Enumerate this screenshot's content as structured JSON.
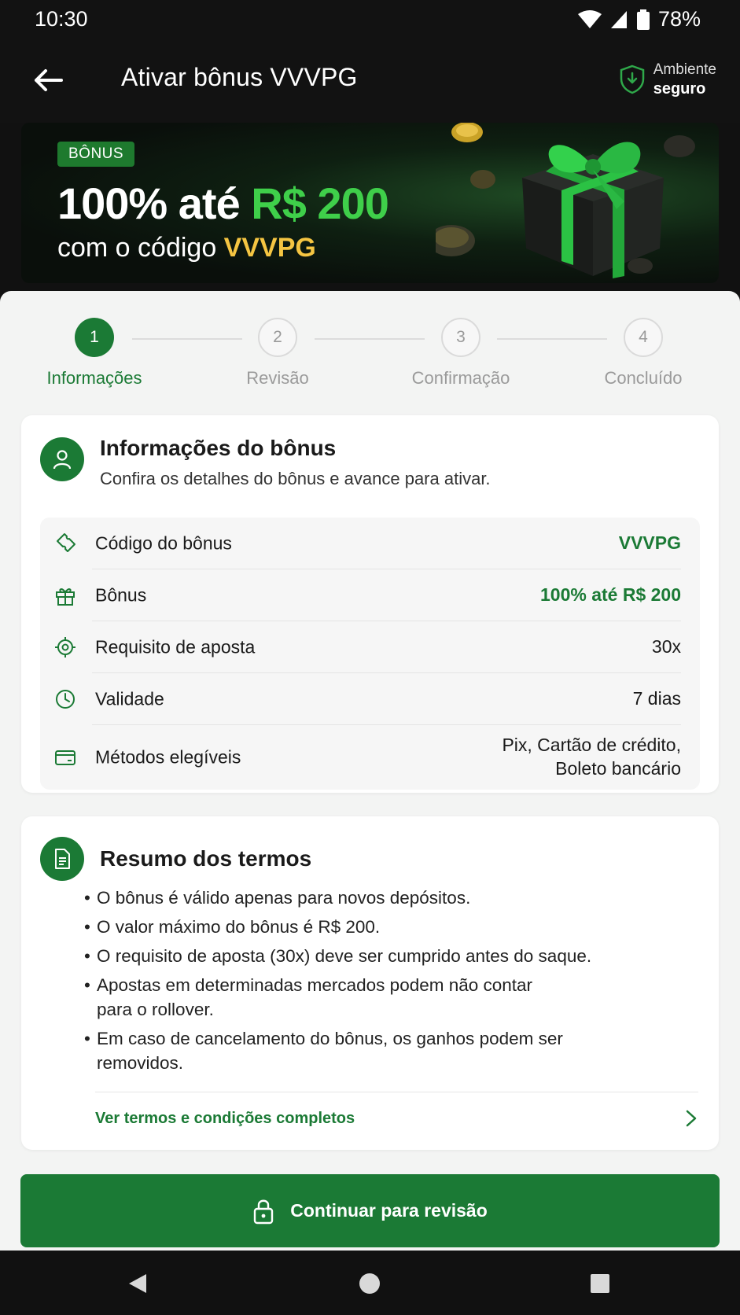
{
  "status_bar": {
    "time": "10:30",
    "battery": "78%",
    "icons": [
      "wifi-icon",
      "signal-icon",
      "battery-icon"
    ]
  },
  "app_bar": {
    "title": "Ativar bônus VVVPG",
    "secure_line1": "Ambiente",
    "secure_line2": "seguro",
    "icons": [
      "back-arrow-icon",
      "shield-icon"
    ]
  },
  "banner": {
    "badge": "BÔNUS",
    "headline_prefix": "100% até ",
    "headline_amount": "R$ 200",
    "sub_prefix": "com o código ",
    "sub_code": "VVVPG"
  },
  "stepper": {
    "steps": [
      {
        "number": "1",
        "label": "Informações",
        "active": true
      },
      {
        "number": "2",
        "label": "Revisão",
        "active": false
      },
      {
        "number": "3",
        "label": "Confirmação",
        "active": false
      },
      {
        "number": "4",
        "label": "Concluído",
        "active": false
      }
    ]
  },
  "info_card": {
    "title": "Informações do bônus",
    "subtitle": "Confira os detalhes do bônus e avance para ativar.",
    "rows": [
      {
        "icon": "ticket-icon",
        "label": "Código do bônus",
        "value": "VVVPG",
        "highlight": true
      },
      {
        "icon": "gift-icon",
        "label": "Bônus",
        "value": "100% até R$ 200",
        "highlight": true
      },
      {
        "icon": "target-icon",
        "label": "Requisito de aposta",
        "value": "30x",
        "highlight": false
      },
      {
        "icon": "clock-icon",
        "label": "Validade",
        "value": "7 dias",
        "highlight": false
      },
      {
        "icon": "card-icon",
        "label": "Métodos elegíveis",
        "value_line1": "Pix, Cartão de crédito,",
        "value_line2": "Boleto bancário",
        "highlight": false
      }
    ]
  },
  "terms_card": {
    "title": "Resumo dos termos",
    "items": [
      "O bônus é válido apenas para novos depósitos.",
      "O valor máximo do bônus é R$ 200.",
      "O requisito de aposta (30x) deve ser cumprido antes do saque.",
      "Apostas em determinadas mercados podem não contar para o rollover.",
      "Em caso de cancelamento do bônus, os ganhos podem ser removidos."
    ],
    "link_label": "Ver termos e condições completos"
  },
  "cta": {
    "label": "Continuar para revisão"
  },
  "colors": {
    "primary_green": "#1b7a35",
    "banner_green": "#3fcf4a",
    "banner_yellow": "#f5c542"
  }
}
